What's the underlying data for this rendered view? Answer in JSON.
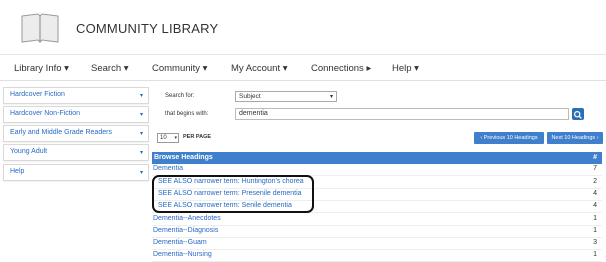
{
  "app": {
    "title": "COMMUNITY LIBRARY",
    "logo_icon": "open-book-icon"
  },
  "nav": {
    "items": [
      {
        "label": "Library Info ▾"
      },
      {
        "label": "Search ▾"
      },
      {
        "label": "Community ▾"
      },
      {
        "label": "My Account ▾"
      },
      {
        "label": "Connections ▸"
      },
      {
        "label": "Help ▾"
      }
    ]
  },
  "sidebar": {
    "items": [
      {
        "label": "Hardcover Fiction",
        "caret": "▾"
      },
      {
        "label": "Hardcover Non-Fiction",
        "caret": "▾"
      },
      {
        "label": "Early and Middle Grade Readers",
        "caret": "▾"
      },
      {
        "label": "Young Adult",
        "caret": "▾"
      },
      {
        "label": "Help",
        "caret": "▾"
      }
    ]
  },
  "search": {
    "search_for_label": "Search for:",
    "search_for_value": "Subject",
    "begins_with_label": "that begins with:",
    "query": "dementia",
    "button_icon": "magnifier-icon"
  },
  "results": {
    "per_page_value": "10",
    "per_page_label": "PER PAGE",
    "prev_label": "‹ Previous 10 Headings",
    "next_label": "Next 10 Headings ›",
    "header_label": "Browse Headings",
    "header_count_label": "#",
    "rows": [
      {
        "heading": "Dementia",
        "count": "7"
      },
      {
        "heading": "SEE ALSO narrower term: Huntington's chorea",
        "count": "2"
      },
      {
        "heading": "SEE ALSO narrower term: Presenile dementia",
        "count": "4"
      },
      {
        "heading": "SEE ALSO narrower term: Senile dementia",
        "count": "4"
      },
      {
        "heading": "Dementia--Anecdotes",
        "count": "1"
      },
      {
        "heading": "Dementia--Diagnosis",
        "count": "1"
      },
      {
        "heading": "Dementia--Guam",
        "count": "3"
      },
      {
        "heading": "Dementia--Nursing",
        "count": "1"
      }
    ]
  },
  "colors": {
    "accent": "#3f7fcc",
    "link": "#2a69c4",
    "annotation_outline": "#111111"
  }
}
